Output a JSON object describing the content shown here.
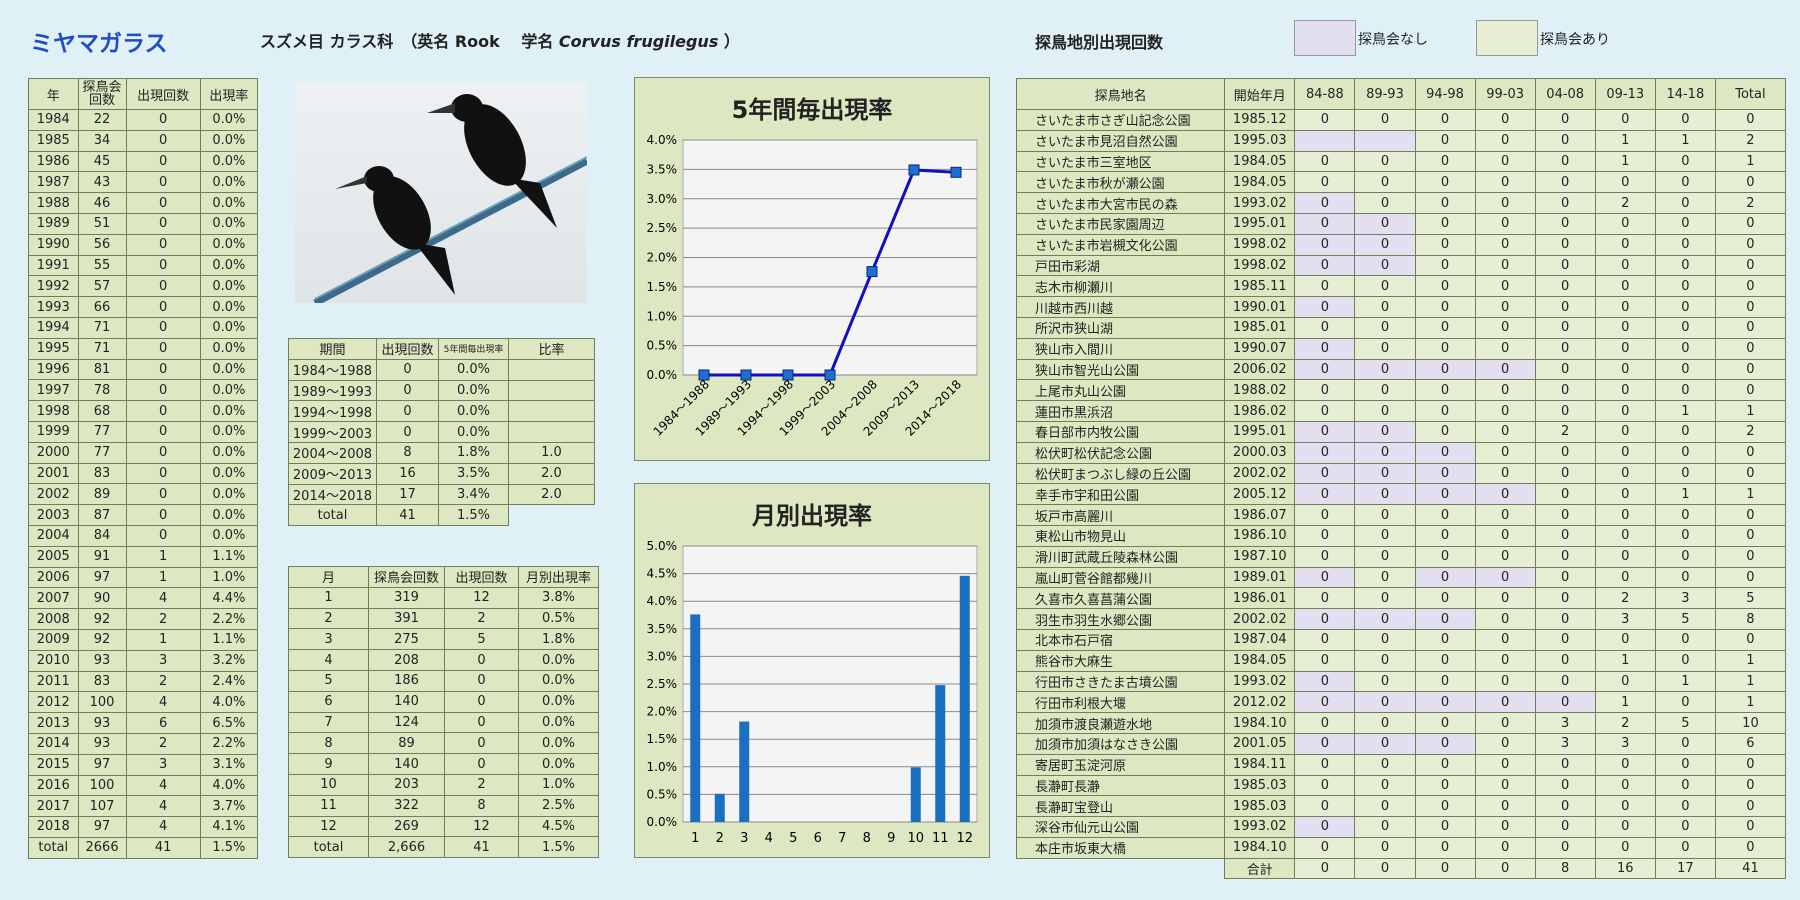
{
  "header": {
    "species": "ミヤマガラス",
    "taxon_prefix": "スズメ目 カラス科　（英名 Rook　 学名 ",
    "sci_name": "Corvus frugilegus",
    "taxon_suffix": " ）",
    "loc_title": "探鳥地別出現回数",
    "legend_none": "探鳥会なし",
    "legend_some": "探鳥会あり",
    "legend_none_color": "#e3def0",
    "legend_some_color": "#e6efd4"
  },
  "year_table": {
    "headers": [
      "年",
      "探鳥会回数",
      "出現回数",
      "出現率"
    ],
    "rows": [
      [
        "1984",
        "22",
        "0",
        "0.0%"
      ],
      [
        "1985",
        "34",
        "0",
        "0.0%"
      ],
      [
        "1986",
        "45",
        "0",
        "0.0%"
      ],
      [
        "1987",
        "43",
        "0",
        "0.0%"
      ],
      [
        "1988",
        "46",
        "0",
        "0.0%"
      ],
      [
        "1989",
        "51",
        "0",
        "0.0%"
      ],
      [
        "1990",
        "56",
        "0",
        "0.0%"
      ],
      [
        "1991",
        "55",
        "0",
        "0.0%"
      ],
      [
        "1992",
        "57",
        "0",
        "0.0%"
      ],
      [
        "1993",
        "66",
        "0",
        "0.0%"
      ],
      [
        "1994",
        "71",
        "0",
        "0.0%"
      ],
      [
        "1995",
        "71",
        "0",
        "0.0%"
      ],
      [
        "1996",
        "81",
        "0",
        "0.0%"
      ],
      [
        "1997",
        "78",
        "0",
        "0.0%"
      ],
      [
        "1998",
        "68",
        "0",
        "0.0%"
      ],
      [
        "1999",
        "77",
        "0",
        "0.0%"
      ],
      [
        "2000",
        "77",
        "0",
        "0.0%"
      ],
      [
        "2001",
        "83",
        "0",
        "0.0%"
      ],
      [
        "2002",
        "89",
        "0",
        "0.0%"
      ],
      [
        "2003",
        "87",
        "0",
        "0.0%"
      ],
      [
        "2004",
        "84",
        "0",
        "0.0%"
      ],
      [
        "2005",
        "91",
        "1",
        "1.1%"
      ],
      [
        "2006",
        "97",
        "1",
        "1.0%"
      ],
      [
        "2007",
        "90",
        "4",
        "4.4%"
      ],
      [
        "2008",
        "92",
        "2",
        "2.2%"
      ],
      [
        "2009",
        "92",
        "1",
        "1.1%"
      ],
      [
        "2010",
        "93",
        "3",
        "3.2%"
      ],
      [
        "2011",
        "83",
        "2",
        "2.4%"
      ],
      [
        "2012",
        "100",
        "4",
        "4.0%"
      ],
      [
        "2013",
        "93",
        "6",
        "6.5%"
      ],
      [
        "2014",
        "93",
        "2",
        "2.2%"
      ],
      [
        "2015",
        "97",
        "3",
        "3.1%"
      ],
      [
        "2016",
        "100",
        "4",
        "4.0%"
      ],
      [
        "2017",
        "107",
        "4",
        "3.7%"
      ],
      [
        "2018",
        "97",
        "4",
        "4.1%"
      ],
      [
        "total",
        "2666",
        "41",
        "1.5%"
      ]
    ]
  },
  "period_table": {
    "headers": [
      "期間",
      "出現回数",
      "5年間毎出現率",
      "比率"
    ],
    "rows": [
      [
        "1984～1988",
        "0",
        "0.0%",
        ""
      ],
      [
        "1989～1993",
        "0",
        "0.0%",
        ""
      ],
      [
        "1994～1998",
        "0",
        "0.0%",
        ""
      ],
      [
        "1999～2003",
        "0",
        "0.0%",
        ""
      ],
      [
        "2004～2008",
        "8",
        "1.8%",
        "1.0"
      ],
      [
        "2009～2013",
        "16",
        "3.5%",
        "2.0"
      ],
      [
        "2014～2018",
        "17",
        "3.4%",
        "2.0"
      ]
    ],
    "total": [
      "total",
      "41",
      "1.5%"
    ]
  },
  "month_table": {
    "headers": [
      "月",
      "探鳥会回数",
      "出現回数",
      "月別出現率"
    ],
    "rows": [
      [
        "1",
        "319",
        "12",
        "3.8%"
      ],
      [
        "2",
        "391",
        "2",
        "0.5%"
      ],
      [
        "3",
        "275",
        "5",
        "1.8%"
      ],
      [
        "4",
        "208",
        "0",
        "0.0%"
      ],
      [
        "5",
        "186",
        "0",
        "0.0%"
      ],
      [
        "6",
        "140",
        "0",
        "0.0%"
      ],
      [
        "7",
        "124",
        "0",
        "0.0%"
      ],
      [
        "8",
        "89",
        "0",
        "0.0%"
      ],
      [
        "9",
        "140",
        "0",
        "0.0%"
      ],
      [
        "10",
        "203",
        "2",
        "1.0%"
      ],
      [
        "11",
        "322",
        "8",
        "2.5%"
      ],
      [
        "12",
        "269",
        "12",
        "4.5%"
      ],
      [
        "total",
        "2,666",
        "41",
        "1.5%"
      ]
    ]
  },
  "chart_data": [
    {
      "type": "line",
      "title": "5年間毎出現率",
      "categories": [
        "1984～1988",
        "1989～1993",
        "1994～1998",
        "1999～2003",
        "2004～2008",
        "2009～2013",
        "2014～2018"
      ],
      "values": [
        0.0,
        0.0,
        0.0,
        0.0,
        1.76,
        3.49,
        3.45
      ],
      "ylim": [
        0,
        4.0
      ],
      "yticks": [
        "0.0%",
        "0.5%",
        "1.0%",
        "1.5%",
        "2.0%",
        "2.5%",
        "3.0%",
        "3.5%",
        "4.0%"
      ],
      "grid": true,
      "color": "#1010c0"
    },
    {
      "type": "bar",
      "title": "月別出現率",
      "categories": [
        "1",
        "2",
        "3",
        "4",
        "5",
        "6",
        "7",
        "8",
        "9",
        "10",
        "11",
        "12"
      ],
      "values": [
        3.76,
        0.51,
        1.82,
        0,
        0,
        0,
        0,
        0,
        0,
        0.99,
        2.48,
        4.46
      ],
      "ylim": [
        0,
        5.0
      ],
      "yticks": [
        "0.0%",
        "0.5%",
        "1.0%",
        "1.5%",
        "2.0%",
        "2.5%",
        "3.0%",
        "3.5%",
        "4.0%",
        "4.5%",
        "5.0%"
      ],
      "grid": true,
      "color": "#1a6fc0"
    }
  ],
  "location_table": {
    "headers": [
      "探鳥地名",
      "開始年月",
      "84-88",
      "89-93",
      "94-98",
      "99-03",
      "04-08",
      "09-13",
      "14-18",
      "Total"
    ],
    "rows": [
      {
        "name": "さいたま市さぎ山記念公園",
        "start": "1985.12",
        "vals": [
          "0",
          "0",
          "0",
          "0",
          "0",
          "0",
          "0",
          "0"
        ],
        "blank": []
      },
      {
        "name": "さいたま市見沼自然公園",
        "start": "1995.03",
        "vals": [
          "",
          "",
          "0",
          "0",
          "0",
          "1",
          "1",
          "2"
        ],
        "blank": [
          0,
          1
        ]
      },
      {
        "name": "さいたま市三室地区",
        "start": "1984.05",
        "vals": [
          "0",
          "0",
          "0",
          "0",
          "0",
          "1",
          "0",
          "1"
        ],
        "blank": []
      },
      {
        "name": "さいたま市秋が瀬公園",
        "start": "1984.05",
        "vals": [
          "0",
          "0",
          "0",
          "0",
          "0",
          "0",
          "0",
          "0"
        ],
        "blank": []
      },
      {
        "name": "さいたま市大宮市民の森",
        "start": "1993.02",
        "vals": [
          "0",
          "0",
          "0",
          "0",
          "0",
          "2",
          "0",
          "2"
        ],
        "blank": [
          0
        ]
      },
      {
        "name": "さいたま市民家園周辺",
        "start": "1995.01",
        "vals": [
          "0",
          "0",
          "0",
          "0",
          "0",
          "0",
          "0",
          "0"
        ],
        "blank": [
          0,
          1
        ]
      },
      {
        "name": "さいたま市岩槻文化公園",
        "start": "1998.02",
        "vals": [
          "0",
          "0",
          "0",
          "0",
          "0",
          "0",
          "0",
          "0"
        ],
        "blank": [
          0,
          1
        ]
      },
      {
        "name": "戸田市彩湖",
        "start": "1998.02",
        "vals": [
          "0",
          "0",
          "0",
          "0",
          "0",
          "0",
          "0",
          "0"
        ],
        "blank": [
          0,
          1
        ]
      },
      {
        "name": "志木市柳瀬川",
        "start": "1985.11",
        "vals": [
          "0",
          "0",
          "0",
          "0",
          "0",
          "0",
          "0",
          "0"
        ],
        "blank": []
      },
      {
        "name": "川越市西川越",
        "start": "1990.01",
        "vals": [
          "0",
          "0",
          "0",
          "0",
          "0",
          "0",
          "0",
          "0"
        ],
        "blank": [
          0
        ]
      },
      {
        "name": "所沢市狭山湖",
        "start": "1985.01",
        "vals": [
          "0",
          "0",
          "0",
          "0",
          "0",
          "0",
          "0",
          "0"
        ],
        "blank": []
      },
      {
        "name": "狭山市入間川",
        "start": "1990.07",
        "vals": [
          "0",
          "0",
          "0",
          "0",
          "0",
          "0",
          "0",
          "0"
        ],
        "blank": [
          0
        ]
      },
      {
        "name": "狭山市智光山公園",
        "start": "2006.02",
        "vals": [
          "0",
          "0",
          "0",
          "0",
          "0",
          "0",
          "0",
          "0"
        ],
        "blank": [
          0,
          1,
          2,
          3
        ]
      },
      {
        "name": "上尾市丸山公園",
        "start": "1988.02",
        "vals": [
          "0",
          "0",
          "0",
          "0",
          "0",
          "0",
          "0",
          "0"
        ],
        "blank": []
      },
      {
        "name": "蓮田市黒浜沼",
        "start": "1986.02",
        "vals": [
          "0",
          "0",
          "0",
          "0",
          "0",
          "0",
          "1",
          "1"
        ],
        "blank": []
      },
      {
        "name": "春日部市内牧公園",
        "start": "1995.01",
        "vals": [
          "0",
          "0",
          "0",
          "0",
          "2",
          "0",
          "0",
          "2"
        ],
        "blank": [
          0,
          1
        ]
      },
      {
        "name": "松伏町松伏記念公園",
        "start": "2000.03",
        "vals": [
          "0",
          "0",
          "0",
          "0",
          "0",
          "0",
          "0",
          "0"
        ],
        "blank": [
          0,
          1,
          2
        ]
      },
      {
        "name": "松伏町まつぶし緑の丘公園",
        "start": "2002.02",
        "vals": [
          "0",
          "0",
          "0",
          "0",
          "0",
          "0",
          "0",
          "0"
        ],
        "blank": [
          0,
          1,
          2
        ]
      },
      {
        "name": "幸手市宇和田公園",
        "start": "2005.12",
        "vals": [
          "0",
          "0",
          "0",
          "0",
          "0",
          "0",
          "1",
          "1"
        ],
        "blank": [
          0,
          1,
          2,
          3
        ]
      },
      {
        "name": "坂戸市高麗川",
        "start": "1986.07",
        "vals": [
          "0",
          "0",
          "0",
          "0",
          "0",
          "0",
          "0",
          "0"
        ],
        "blank": []
      },
      {
        "name": "東松山市物見山",
        "start": "1986.10",
        "vals": [
          "0",
          "0",
          "0",
          "0",
          "0",
          "0",
          "0",
          "0"
        ],
        "blank": []
      },
      {
        "name": "滑川町武蔵丘陵森林公園",
        "start": "1987.10",
        "vals": [
          "0",
          "0",
          "0",
          "0",
          "0",
          "0",
          "0",
          "0"
        ],
        "blank": []
      },
      {
        "name": "嵐山町菅谷館都幾川",
        "start": "1989.01",
        "vals": [
          "0",
          "0",
          "0",
          "0",
          "0",
          "0",
          "0",
          "0"
        ],
        "blank": [
          0,
          2,
          3
        ]
      },
      {
        "name": "久喜市久喜菖蒲公園",
        "start": "1986.01",
        "vals": [
          "0",
          "0",
          "0",
          "0",
          "0",
          "2",
          "3",
          "5"
        ],
        "blank": []
      },
      {
        "name": "羽生市羽生水郷公園",
        "start": "2002.02",
        "vals": [
          "0",
          "0",
          "0",
          "0",
          "0",
          "3",
          "5",
          "8"
        ],
        "blank": [
          0,
          1,
          2
        ]
      },
      {
        "name": "北本市石戸宿",
        "start": "1987.04",
        "vals": [
          "0",
          "0",
          "0",
          "0",
          "0",
          "0",
          "0",
          "0"
        ],
        "blank": []
      },
      {
        "name": "熊谷市大麻生",
        "start": "1984.05",
        "vals": [
          "0",
          "0",
          "0",
          "0",
          "0",
          "1",
          "0",
          "1"
        ],
        "blank": []
      },
      {
        "name": "行田市さきたま古墳公園",
        "start": "1993.02",
        "vals": [
          "0",
          "0",
          "0",
          "0",
          "0",
          "0",
          "1",
          "1"
        ],
        "blank": [
          0
        ]
      },
      {
        "name": "行田市利根大堰",
        "start": "2012.02",
        "vals": [
          "0",
          "0",
          "0",
          "0",
          "0",
          "1",
          "0",
          "1"
        ],
        "blank": [
          0,
          1,
          2,
          3,
          4
        ]
      },
      {
        "name": "加須市渡良瀬遊水地",
        "start": "1984.10",
        "vals": [
          "0",
          "0",
          "0",
          "0",
          "3",
          "2",
          "5",
          "10"
        ],
        "blank": []
      },
      {
        "name": "加須市加須はなさき公園",
        "start": "2001.05",
        "vals": [
          "0",
          "0",
          "0",
          "0",
          "3",
          "3",
          "0",
          "6"
        ],
        "blank": [
          0,
          1,
          2
        ]
      },
      {
        "name": "寄居町玉淀河原",
        "start": "1984.11",
        "vals": [
          "0",
          "0",
          "0",
          "0",
          "0",
          "0",
          "0",
          "0"
        ],
        "blank": []
      },
      {
        "name": "長瀞町長瀞",
        "start": "1985.03",
        "vals": [
          "0",
          "0",
          "0",
          "0",
          "0",
          "0",
          "0",
          "0"
        ],
        "blank": []
      },
      {
        "name": "長瀞町宝登山",
        "start": "1985.03",
        "vals": [
          "0",
          "0",
          "0",
          "0",
          "0",
          "0",
          "0",
          "0"
        ],
        "blank": []
      },
      {
        "name": "深谷市仙元山公園",
        "start": "1993.02",
        "vals": [
          "0",
          "0",
          "0",
          "0",
          "0",
          "0",
          "0",
          "0"
        ],
        "blank": [
          0
        ]
      },
      {
        "name": "本庄市坂東大橋",
        "start": "1984.10",
        "vals": [
          "0",
          "0",
          "0",
          "0",
          "0",
          "0",
          "0",
          "0"
        ],
        "blank": []
      }
    ],
    "total_label": "合計",
    "totals": [
      "0",
      "0",
      "0",
      "0",
      "8",
      "16",
      "17",
      "41"
    ]
  }
}
